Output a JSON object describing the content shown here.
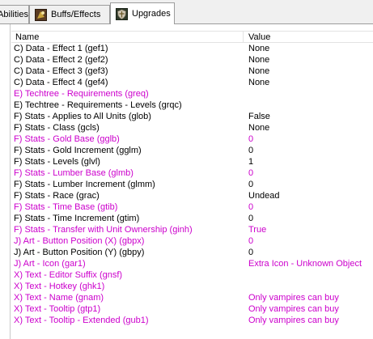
{
  "tabs": [
    {
      "label": "Abilities",
      "active": false
    },
    {
      "label": "Buffs/Effects",
      "active": false,
      "icon": "buffs-icon"
    },
    {
      "label": "Upgrades",
      "active": true,
      "icon": "upgrade-shield-icon"
    }
  ],
  "table": {
    "columns": {
      "name": "Name",
      "value": "Value"
    },
    "rows": [
      {
        "name": "C) Data - Effect 1 (gef1)",
        "value": "None",
        "modified": false
      },
      {
        "name": "C) Data - Effect 2 (gef2)",
        "value": "None",
        "modified": false
      },
      {
        "name": "C) Data - Effect 3 (gef3)",
        "value": "None",
        "modified": false
      },
      {
        "name": "C) Data - Effect 4 (gef4)",
        "value": "None",
        "modified": false
      },
      {
        "name": "E) Techtree - Requirements (greq)",
        "value": "",
        "modified": true
      },
      {
        "name": "E) Techtree - Requirements - Levels (grqc)",
        "value": "",
        "modified": false
      },
      {
        "name": "F) Stats - Applies to All Units (glob)",
        "value": "False",
        "modified": false
      },
      {
        "name": "F) Stats - Class (gcls)",
        "value": "None",
        "modified": false
      },
      {
        "name": "F) Stats - Gold Base (gglb)",
        "value": "0",
        "modified": true
      },
      {
        "name": "F) Stats - Gold Increment (gglm)",
        "value": "0",
        "modified": false
      },
      {
        "name": "F) Stats - Levels (glvl)",
        "value": "1",
        "modified": false
      },
      {
        "name": "F) Stats - Lumber Base (glmb)",
        "value": "0",
        "modified": true
      },
      {
        "name": "F) Stats - Lumber Increment (glmm)",
        "value": "0",
        "modified": false
      },
      {
        "name": "F) Stats - Race (grac)",
        "value": "Undead",
        "modified": false
      },
      {
        "name": "F) Stats - Time Base (gtib)",
        "value": "0",
        "modified": true
      },
      {
        "name": "F) Stats - Time Increment (gtim)",
        "value": "0",
        "modified": false
      },
      {
        "name": "F) Stats - Transfer with Unit Ownership (ginh)",
        "value": "True",
        "modified": true
      },
      {
        "name": "J) Art - Button Position (X) (gbpx)",
        "value": "0",
        "modified": true
      },
      {
        "name": "J) Art - Button Position (Y) (gbpy)",
        "value": "0",
        "modified": false
      },
      {
        "name": "J) Art - Icon (gar1)",
        "value": "Extra Icon - Unknown Object",
        "modified": true
      },
      {
        "name": "X) Text - Editor Suffix (gnsf)",
        "value": "",
        "modified": true
      },
      {
        "name": "X) Text - Hotkey (ghk1)",
        "value": "",
        "modified": true
      },
      {
        "name": "X) Text - Name (gnam)",
        "value": "Only vampires can buy",
        "modified": true
      },
      {
        "name": "X) Text - Tooltip (gtp1)",
        "value": "Only vampires can buy",
        "modified": true
      },
      {
        "name": "X) Text - Tooltip - Extended (gub1)",
        "value": "Only vampires can buy",
        "modified": true
      }
    ]
  },
  "colors": {
    "modified_text": "#cc00cc",
    "normal_text": "#000000"
  }
}
